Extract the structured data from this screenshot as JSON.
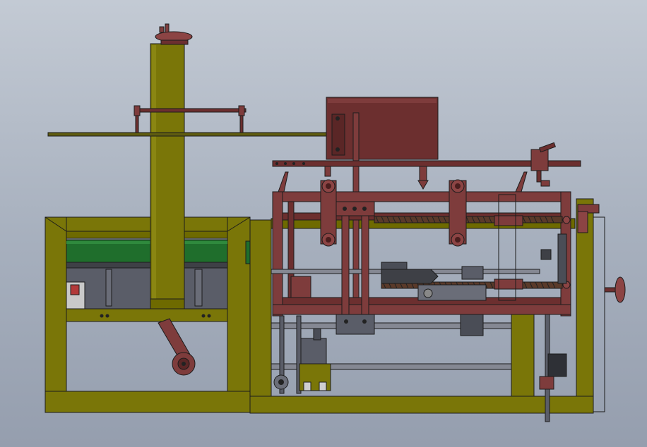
{
  "colors": {
    "background_top": "#c3cad4",
    "background_bottom": "#959eae",
    "frame_olive": "#6e6a00",
    "frame_olive_face": "#7a7608",
    "frame_olive_dark": "#55520a",
    "carriage_red": "#6c2f2f",
    "carriage_red_light": "#7e3c3c",
    "conveyor_green": "#1f6e2c",
    "machine_grey": "#5a5d68",
    "rod_grey": "#858893",
    "outline": "#1c1c1c"
  },
  "view": {
    "description_visible_text": ""
  }
}
